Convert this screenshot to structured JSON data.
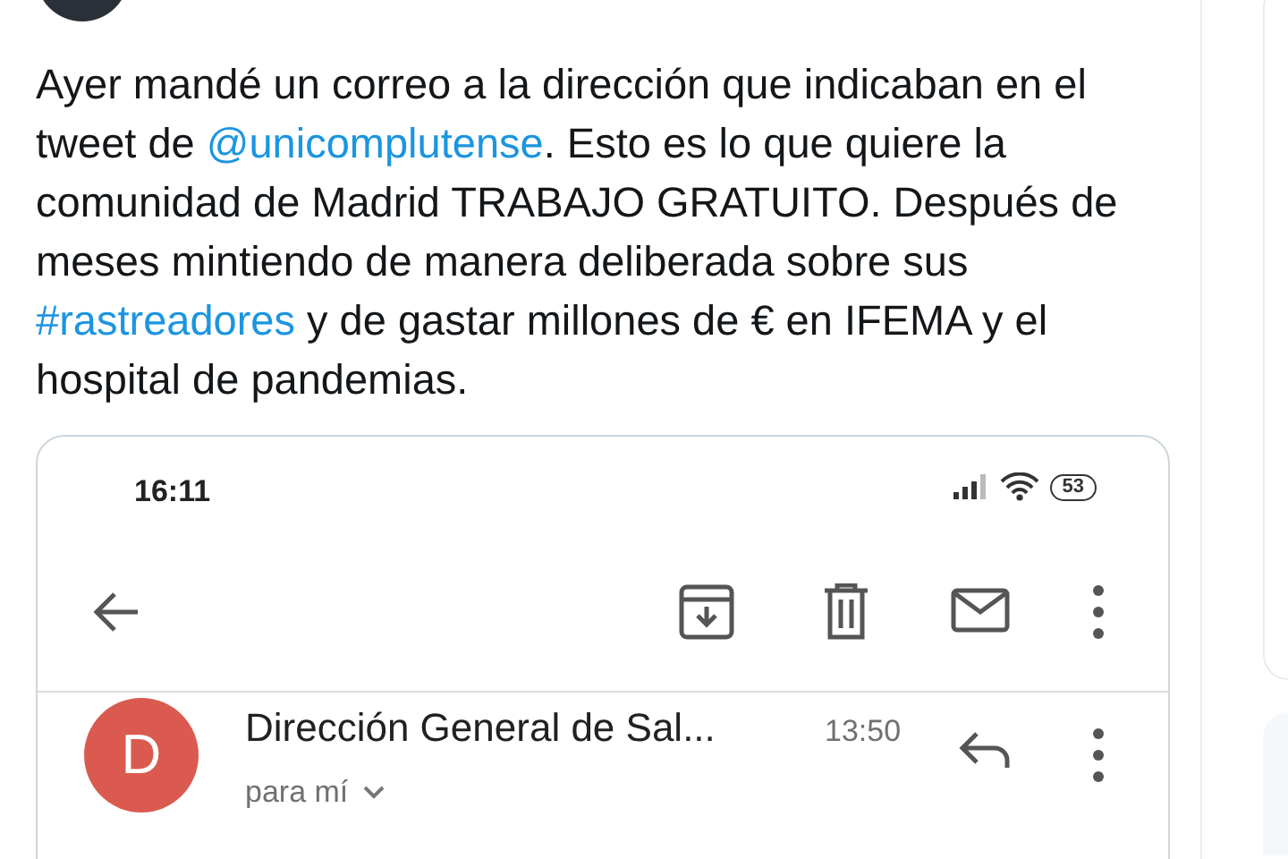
{
  "tweet": {
    "segments": [
      {
        "kind": "plain",
        "text": "Ayer mandé un correo a la dirección que indicaban en el tweet de "
      },
      {
        "kind": "mention",
        "text": "@unicomplutense"
      },
      {
        "kind": "plain",
        "text": ". Esto es lo que quiere la comunidad de Madrid TRABAJO GRATUITO. Después de meses mintiendo de manera deliberada sobre sus "
      },
      {
        "kind": "hashtag",
        "text": "#rastreadores"
      },
      {
        "kind": "plain",
        "text": " y de gastar millones de € en IFEMA y el hospital de pandemias."
      }
    ],
    "media": {
      "status_time": "16:11",
      "battery": "53",
      "email": {
        "avatar_letter": "D",
        "sender": "Dirección General de Sal...",
        "time": "13:50",
        "recipient": "para mí"
      }
    }
  }
}
